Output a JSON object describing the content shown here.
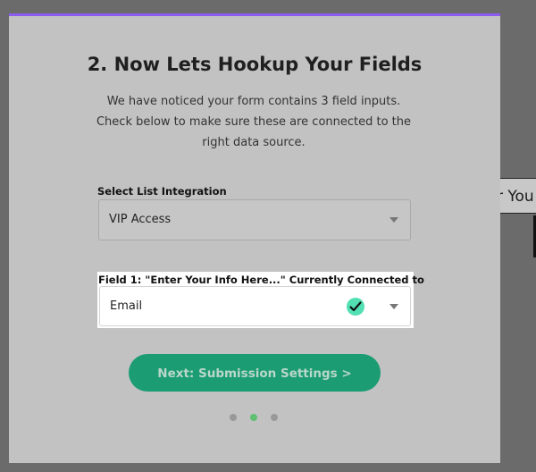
{
  "background": {
    "fragment_text": "r You"
  },
  "modal": {
    "title": "2. Now Lets Hookup Your Fields",
    "description": "We have noticed your form contains 3 field inputs. Check below to make sure these are connected to the right data source.",
    "list_integration": {
      "label": "Select List Integration",
      "value": "VIP Access"
    },
    "field1": {
      "label": "Field 1: \"Enter Your Info Here...\" Currently Connected to",
      "value": "Email",
      "status_icon": "check-circle-icon"
    },
    "next_button_label": "Next: Submission Settings >",
    "steps": {
      "count": 3,
      "active": 2
    }
  },
  "colors": {
    "accent_bar": "#8b5cf0",
    "button": "#1b9c72",
    "check": "#52e0b3",
    "active_dot": "#5fbf72"
  }
}
